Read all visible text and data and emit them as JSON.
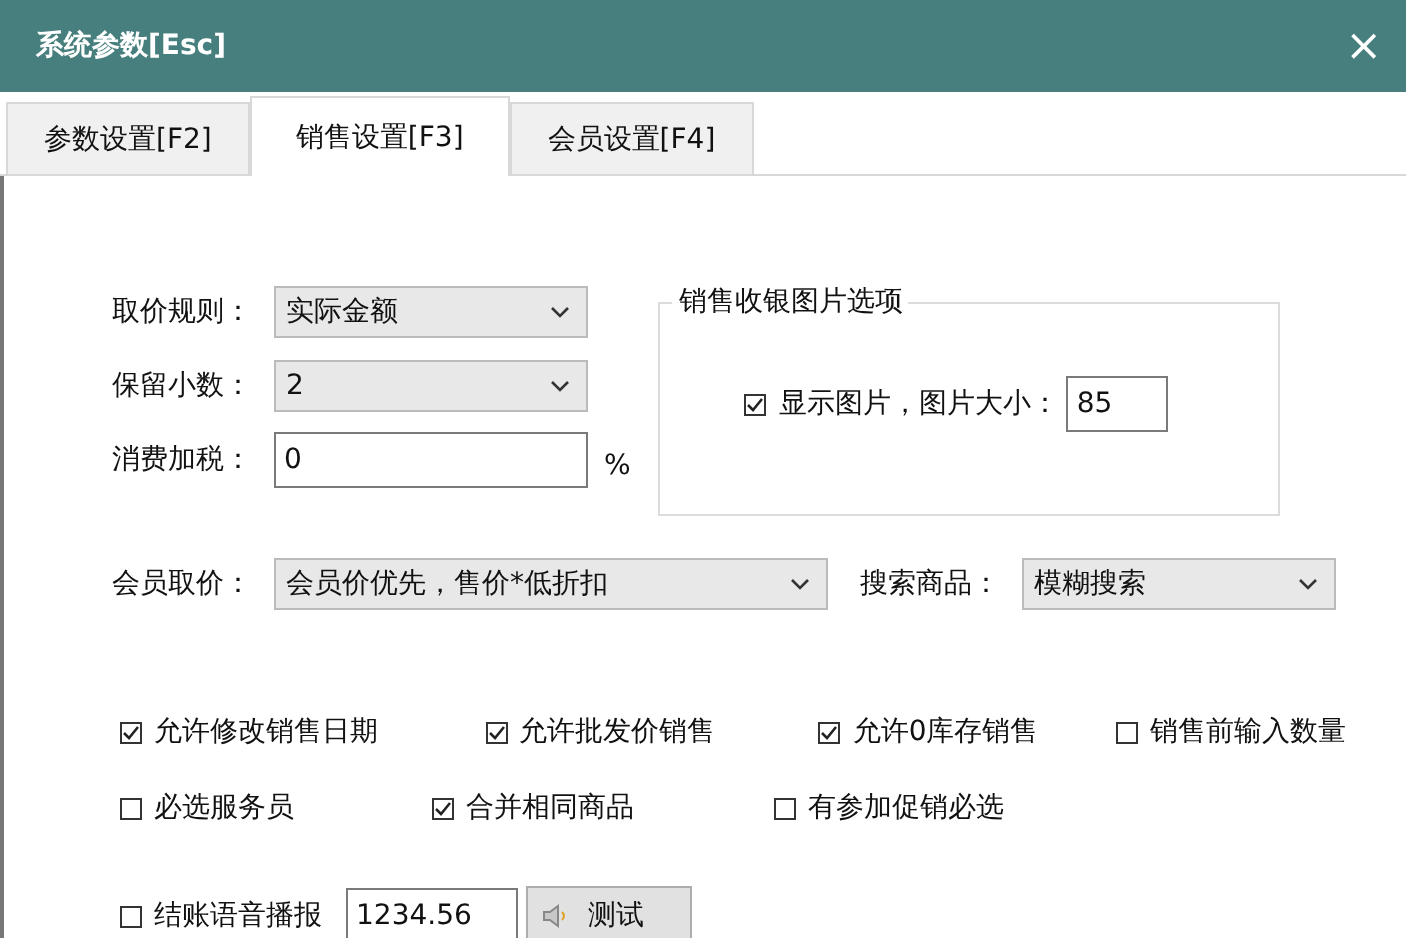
{
  "window": {
    "title": "系统参数[Esc]",
    "close": "×"
  },
  "tabs": [
    {
      "label": "参数设置[F2]",
      "selected": false
    },
    {
      "label": "销售设置[F3]",
      "selected": true
    },
    {
      "label": "会员设置[F4]",
      "selected": false
    }
  ],
  "pricing": {
    "price_rule": {
      "label": "取价规则：",
      "value": "实际金额"
    },
    "decimals": {
      "label": "保留小数：",
      "value": "2"
    },
    "tax": {
      "label": "消费加税：",
      "value": "0",
      "unit": "%"
    }
  },
  "image_group": {
    "title": "销售收银图片选项",
    "show_image": {
      "label": "显示图片，图片大小：",
      "checked": true
    },
    "size": "85"
  },
  "member_price": {
    "label": "会员取价：",
    "value": "会员价优先，售价*低折扣"
  },
  "search": {
    "label": "搜索商品：",
    "value": "模糊搜索"
  },
  "options": [
    [
      {
        "label": "允许修改销售日期",
        "checked": true
      },
      {
        "label": "允许批发价销售",
        "checked": true
      },
      {
        "label": "允许0库存销售",
        "checked": true
      },
      {
        "label": "销售前输入数量",
        "checked": false
      }
    ],
    [
      {
        "label": "必选服务员",
        "checked": false
      },
      {
        "label": "合并相同商品",
        "checked": true
      },
      {
        "label": "有参加促销必选",
        "checked": false
      }
    ]
  ],
  "voice": {
    "label": "结账语音播报",
    "checked": false,
    "value": "1234.56",
    "button": "测试"
  }
}
